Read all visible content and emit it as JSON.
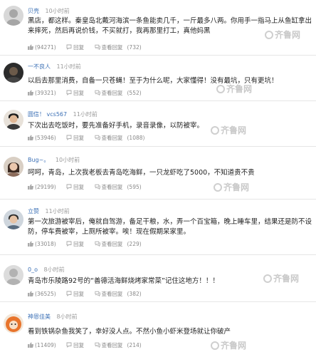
{
  "actions": {
    "reply_label": "回复",
    "view_replies_label": "查看回复"
  },
  "watermark": {
    "text": "齐鲁网"
  },
  "comments": [
    {
      "username": "贝壳",
      "time": "10小时前",
      "text": "黑店，都这样。秦皇岛北戴河海滨一条鱼能卖几千，一斤最多八两。你用手一指马上从鱼缸拿出来摔死，然后再说价钱，不买就打，我再那里打工，真他妈黑",
      "likes": "(94271)",
      "reply_count": "(732)"
    },
    {
      "username": "一不良人",
      "time": "11小时前",
      "text": "以后去那里消费，自备一只苍蝇！至于为什么呢，大家懂得！没有最坑，只有更坑！",
      "likes": "(39321)",
      "reply_count": "(552)"
    },
    {
      "username": "圆信！ vcs567",
      "time": "11小时前",
      "text": "下次出去吃饭时，要先准备好手机，录音录像，以防被宰。",
      "likes": "(53946)",
      "reply_count": "(1088)"
    },
    {
      "username": "Bug~。",
      "time": "10小时前",
      "text": "呵呵，青岛，上次我老板去青岛吃海鲜，一只龙虾吃了5000，不知道贵不贵",
      "likes": "(29199)",
      "reply_count": "(595)"
    },
    {
      "username": "立赞",
      "time": "11小时前",
      "text": "第一次旅游被宰后，俺就自驾游，备足干粮，水，弄一个百宝箱，晚上睡车里，结果还是防不设防，停车费被宰，上厕所被宰。唉！现在假期呆家里。",
      "likes": "(33018)",
      "reply_count": "(229)"
    },
    {
      "username": "0_o",
      "time": "8小时前",
      "text": "青岛市乐陵路92号的“善德活海鲜烧烤家常菜”记住这地方！！！",
      "likes": "(36525)",
      "reply_count": "(382)"
    },
    {
      "username": "神恩佳美",
      "time": "8小时前",
      "text": "看到铁锅杂鱼我笑了，幸好没人点。不然小鱼小虾米登场就让你破产",
      "likes": "(11409)",
      "reply_count": "(214)"
    }
  ]
}
